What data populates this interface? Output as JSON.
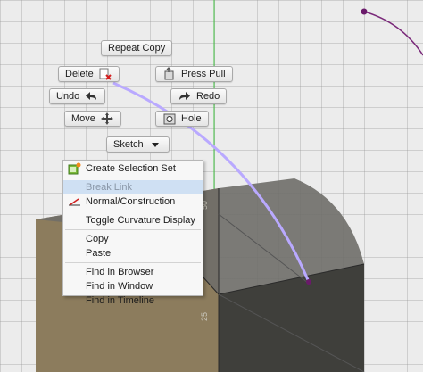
{
  "viewport": {
    "marking_menu": {
      "repeat_copy": "Repeat Copy",
      "delete": "Delete",
      "press_pull": "Press Pull",
      "undo": "Undo",
      "redo": "Redo",
      "move": "Move",
      "hole": "Hole",
      "sketch": "Sketch"
    },
    "dimensions": {
      "label_top": "50",
      "label_bottom": "25"
    }
  },
  "context_menu": {
    "items": [
      {
        "label": "Create Selection Set",
        "icon": "selection-set-icon"
      },
      {
        "label": "Break Link",
        "state": "highlighted-disabled"
      },
      {
        "label": "Normal/Construction",
        "icon": "construction-line-icon"
      },
      {
        "label": "Toggle Curvature Display"
      },
      {
        "label": "Copy"
      },
      {
        "label": "Paste"
      },
      {
        "label": "Find in Browser"
      },
      {
        "label": "Find in Window"
      },
      {
        "label": "Find in Timeline"
      }
    ]
  },
  "colors": {
    "grid_background": "#ececec",
    "solid_front": "#3f3f3b",
    "solid_top": "#6f6e69",
    "solid_left_tan": "#8c7c5d",
    "sketch_curve": "#b9a9ff",
    "sketch_point": "#6a1a6a",
    "menu_highlight": "#cfe0f3",
    "green_axis": "#3fbf3f"
  }
}
